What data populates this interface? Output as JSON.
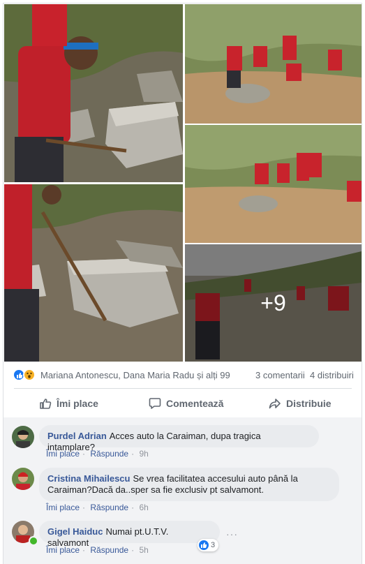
{
  "post": {
    "more_photos": "+9",
    "reactions": {
      "names": "Mariana Antonescu, Dana Maria Radu și alți 99",
      "comments": "3 comentarii",
      "shares": "4 distribuiri",
      "icons": [
        "like-icon",
        "wow-icon"
      ]
    },
    "actions": {
      "like": "Îmi place",
      "comment": "Comentează",
      "share": "Distribuie"
    }
  },
  "comments": [
    {
      "author": "Purdel Adrian",
      "text": "Acces auto la Caraiman, dupa tragica intamplare?",
      "like": "Îmi place",
      "reply": "Răspunde",
      "time": "9h"
    },
    {
      "author": "Cristina Mihailescu",
      "text": "Se vrea facilitatea accesului auto până la Caraiman?Dacă da..sper sa fie exclusiv pt salvamont.",
      "like": "Îmi place",
      "reply": "Răspunde",
      "time": "6h"
    },
    {
      "author": "Gigel Haiduc",
      "text": "Numai pt.U.T.V. salvamont",
      "like": "Îmi place",
      "reply": "Răspunde",
      "time": "5h",
      "likes": "3",
      "menu": "···"
    }
  ],
  "colors": {
    "link": "#385898",
    "accent": "#1877f2",
    "muted": "#606770"
  }
}
